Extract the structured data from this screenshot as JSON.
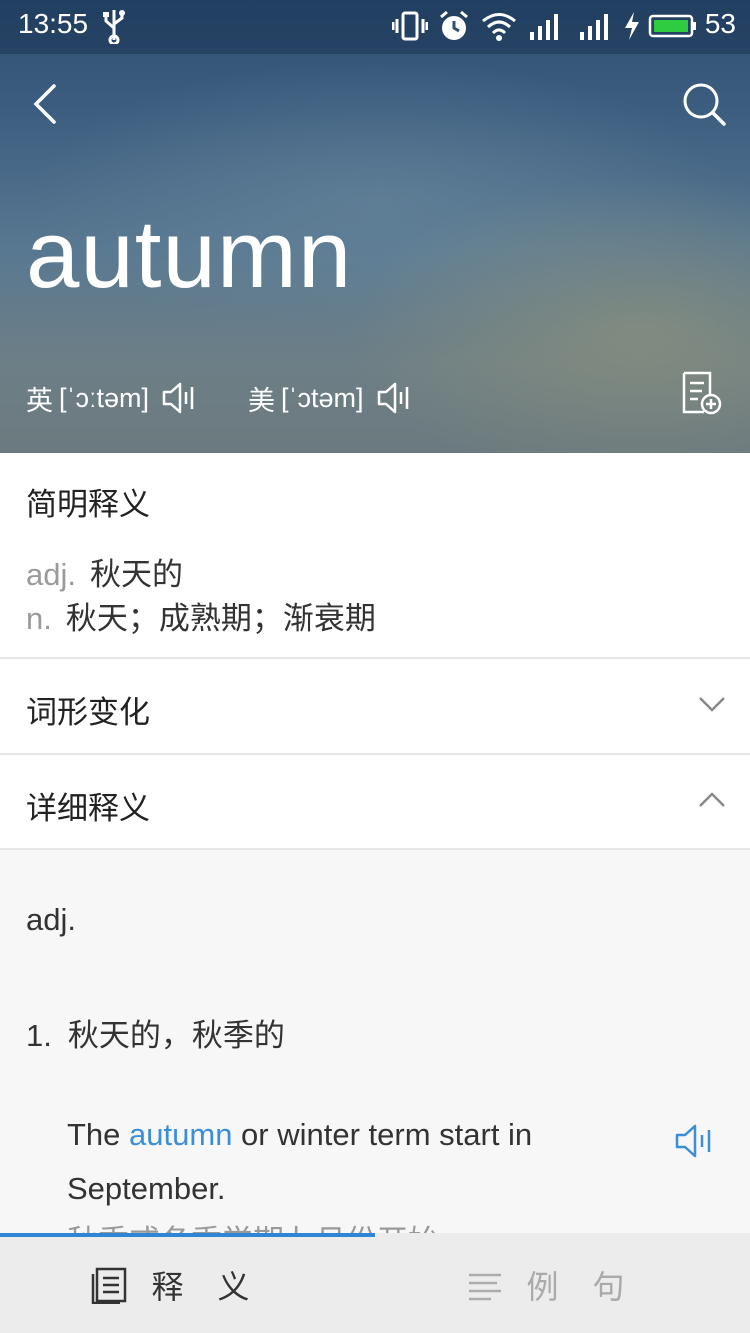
{
  "status_bar": {
    "time": "13:55",
    "battery": "53",
    "icons": [
      "usb-icon",
      "vibrate-icon",
      "alarm-icon",
      "wifi-icon",
      "signal-icon",
      "signal-icon",
      "charging-icon",
      "battery-icon"
    ],
    "battery_color": "#2ecc40"
  },
  "header": {
    "word": "autumn",
    "uk": {
      "tag": "英",
      "phonetic": "[ˈɔːtəm]"
    },
    "us": {
      "tag": "美",
      "phonetic": "[ˈɔtəm]"
    }
  },
  "brief": {
    "title": "简明释义",
    "defs": [
      {
        "pos": "adj.",
        "text": "秋天的"
      },
      {
        "pos": "n.",
        "text": "秋天；成熟期；渐衰期"
      }
    ]
  },
  "sections": {
    "forms": {
      "label": "词形变化",
      "expanded": false
    },
    "detail": {
      "label": "详细释义",
      "expanded": true
    }
  },
  "detail": {
    "pos": "adj.",
    "sense_num": "1.",
    "sense_text": "秋天的，秋季的",
    "example_before": "The ",
    "example_highlight": "autumn",
    "example_after": " or winter term start in September.",
    "example_translation": "秋季或冬季学期九月份开始。"
  },
  "tabs": {
    "definition": "释义",
    "examples": "例句",
    "active": "definition",
    "accent_color": "#2f86d3"
  }
}
